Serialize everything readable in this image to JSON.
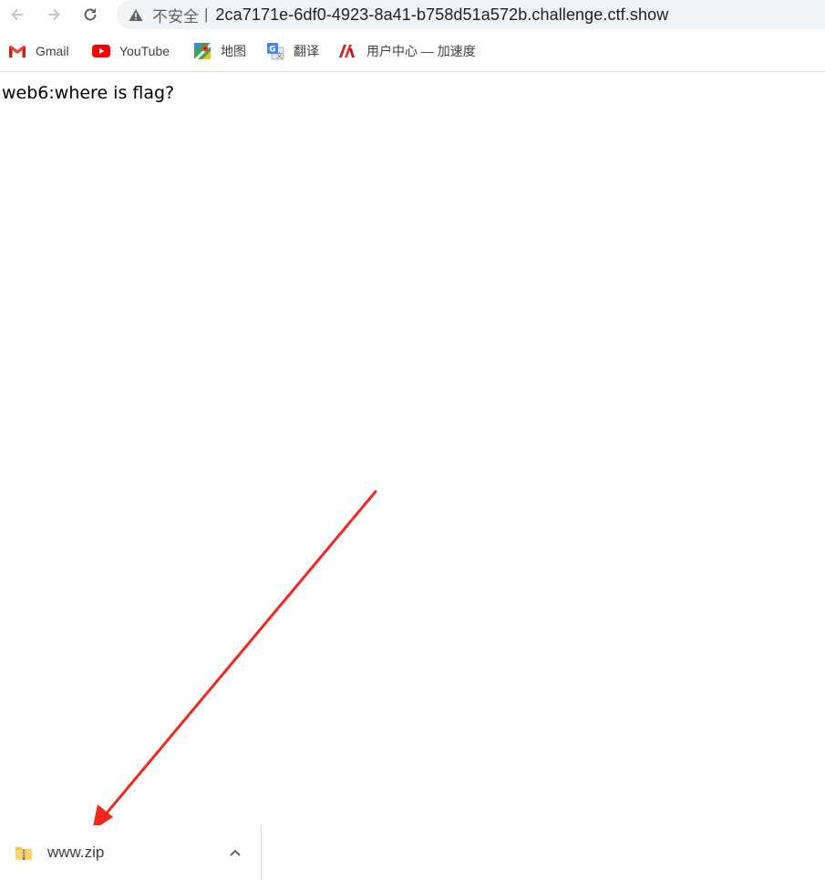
{
  "toolbar": {
    "security_label": "不安全",
    "separator": "|",
    "url": "2ca7171e-6df0-4923-8a41-b758d51a572b.challenge.ctf.show"
  },
  "bookmarks": [
    {
      "label": "Gmail",
      "icon": "gmail-icon"
    },
    {
      "label": "YouTube",
      "icon": "youtube-icon"
    },
    {
      "label": "地图",
      "icon": "maps-icon"
    },
    {
      "label": "翻译",
      "icon": "translate-icon"
    },
    {
      "label": "用户中心 — 加速度",
      "icon": "site-logo-icon"
    }
  ],
  "page": {
    "heading": "web6:where is flag?"
  },
  "downloads": {
    "items": [
      {
        "filename": "www.zip",
        "icon": "zip-folder-icon"
      }
    ]
  },
  "colors": {
    "annotation_arrow": "#f0281e",
    "omnibox_bg": "#f1f3f4"
  }
}
